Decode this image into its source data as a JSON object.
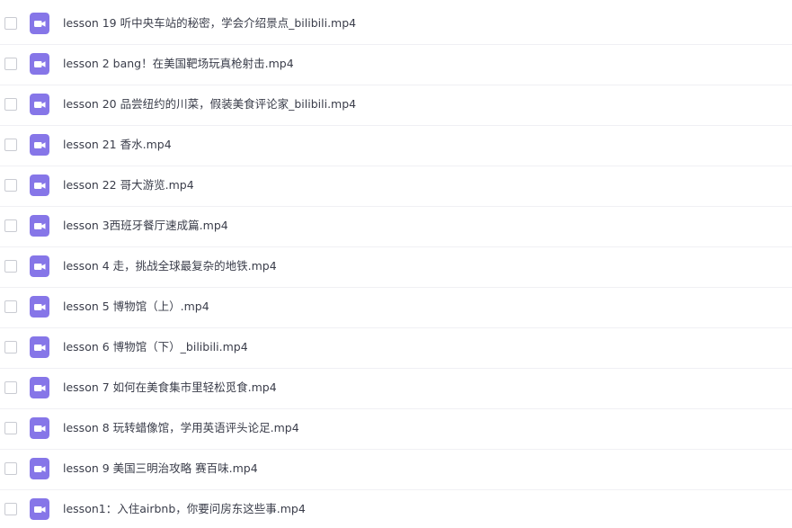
{
  "colors": {
    "icon_bg": "#8676e8",
    "icon_glyph": "#ffffff",
    "text": "#3a3d4a",
    "divider": "#f0f0f4",
    "checkbox_border": "#c9cbd2"
  },
  "file_list": {
    "icon": "video-file-icon",
    "items": [
      {
        "name": "lesson 19 听中央车站的秘密，学会介绍景点_bilibili.mp4"
      },
      {
        "name": "lesson 2 bang！在美国靶场玩真枪射击.mp4"
      },
      {
        "name": "lesson 20 品尝纽约的川菜，假装美食评论家_bilibili.mp4"
      },
      {
        "name": "lesson 21 香水.mp4"
      },
      {
        "name": "lesson 22 哥大游览.mp4"
      },
      {
        "name": "lesson 3西班牙餐厅速成篇.mp4"
      },
      {
        "name": "lesson 4 走，挑战全球最复杂的地铁.mp4"
      },
      {
        "name": "lesson 5 博物馆（上）.mp4"
      },
      {
        "name": "lesson 6 博物馆（下）_bilibili.mp4"
      },
      {
        "name": "lesson 7 如何在美食集市里轻松觅食.mp4"
      },
      {
        "name": "lesson 8 玩转蜡像馆，学用英语评头论足.mp4"
      },
      {
        "name": "lesson 9 美国三明治攻略 赛百味.mp4"
      },
      {
        "name": "lesson1：入住airbnb，你要问房东这些事.mp4"
      }
    ]
  }
}
